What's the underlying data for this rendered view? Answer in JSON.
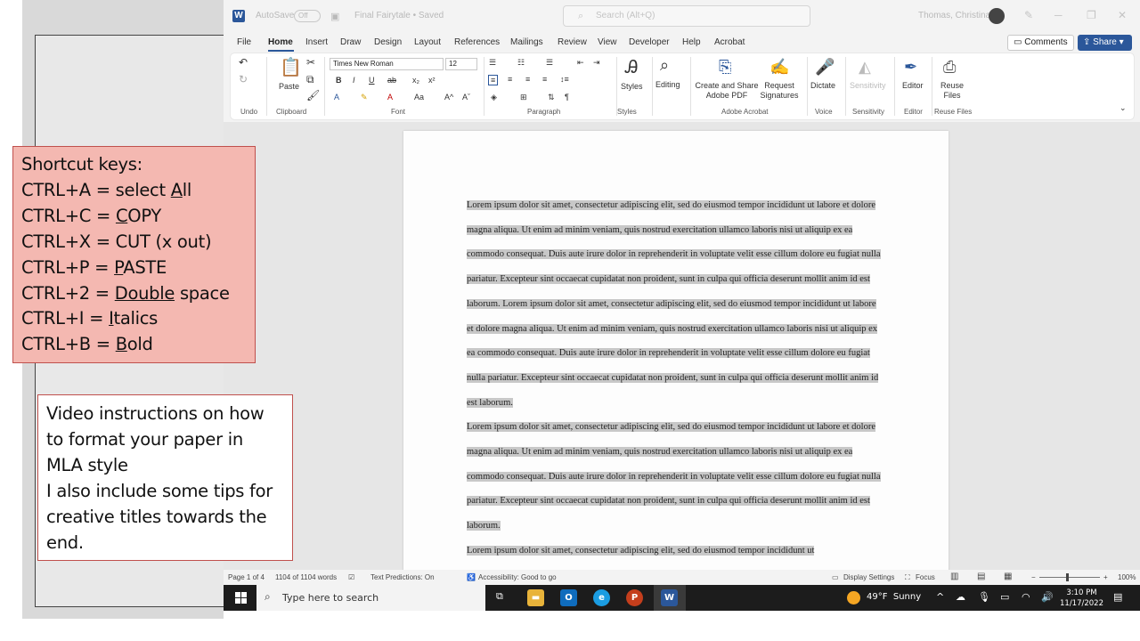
{
  "titlebar": {
    "autosave_label": "AutoSave",
    "autosave_state": "Off",
    "document_title": "Final Fairytale • Saved",
    "search_placeholder": "Search (Alt+Q)",
    "user_name": "Thomas, Christina"
  },
  "menu": {
    "tabs": [
      "File",
      "Home",
      "Insert",
      "Draw",
      "Design",
      "Layout",
      "References",
      "Mailings",
      "Review",
      "View",
      "Developer",
      "Help",
      "Acrobat"
    ],
    "active_tab": "Home",
    "comments_label": "Comments",
    "share_label": "Share"
  },
  "ribbon": {
    "paste_label": "Paste",
    "font_name": "Times New Roman",
    "font_size": "12",
    "styles_label": "Styles",
    "editing_label": "Editing",
    "create_share_label_1": "Create and Share",
    "create_share_label_2": "Adobe PDF",
    "request_sig_label_1": "Request",
    "request_sig_label_2": "Signatures",
    "dictate_label": "Dictate",
    "sensitivity_label": "Sensitivity",
    "editor_label": "Editor",
    "reuse_label_1": "Reuse",
    "reuse_label_2": "Files",
    "groups": {
      "undo": "Undo",
      "clipboard": "Clipboard",
      "font": "Font",
      "paragraph": "Paragraph",
      "styles": "Styles",
      "acrobat": "Adobe Acrobat",
      "voice": "Voice",
      "sensitivity": "Sensitivity",
      "editor": "Editor",
      "reuse": "Reuse Files"
    }
  },
  "document": {
    "paragraph_1": "Lorem ipsum dolor sit amet, consectetur adipiscing elit, sed do eiusmod tempor incididunt ut labore et dolore magna aliqua. Ut enim ad minim veniam, quis nostrud exercitation ullamco laboris nisi ut aliquip ex ea commodo consequat. Duis aute irure dolor in reprehenderit in voluptate velit esse cillum dolore eu fugiat nulla pariatur. Excepteur sint occaecat cupidatat non proident, sunt in culpa qui officia deserunt mollit anim id est laborum. Lorem ipsum dolor sit amet, consectetur adipiscing elit, sed do eiusmod tempor incididunt ut labore et dolore magna aliqua. Ut enim ad minim veniam, quis nostrud exercitation ullamco laboris nisi ut aliquip ex ea commodo consequat. Duis aute irure dolor in reprehenderit in voluptate velit esse cillum dolore eu fugiat nulla pariatur. Excepteur sint occaecat cupidatat non proident, sunt in culpa qui officia deserunt mollit anim id est laborum.",
    "paragraph_2": "Lorem ipsum dolor sit amet, consectetur adipiscing elit, sed do eiusmod tempor incididunt ut labore et dolore magna aliqua. Ut enim ad minim veniam, quis nostrud exercitation ullamco laboris nisi ut aliquip ex ea commodo consequat. Duis aute irure dolor in reprehenderit in voluptate velit esse cillum dolore eu fugiat nulla pariatur. Excepteur sint occaecat cupidatat non proident, sunt in culpa qui officia deserunt mollit anim id est laborum.",
    "paragraph_3": "Lorem ipsum dolor sit amet, consectetur adipiscing elit, sed do eiusmod tempor incididunt ut"
  },
  "statusbar": {
    "page": "Page 1 of 4",
    "words": "1104 of 1104 words",
    "text_predictions": "Text Predictions: On",
    "accessibility": "Accessibility: Good to go",
    "display_settings": "Display Settings",
    "focus": "Focus",
    "zoom": "100%"
  },
  "taskbar": {
    "search_placeholder": "Type here to search",
    "weather_temp": "49°F",
    "weather_desc": "Sunny",
    "time": "3:10 PM",
    "date": "11/17/2022"
  },
  "overlay": {
    "shortcuts_title": "Shortcut keys:",
    "shortcuts": [
      {
        "prefix": "CTRL+A = select ",
        "underlined": "A",
        "suffix": "ll"
      },
      {
        "prefix": "CTRL+C = ",
        "underlined": "C",
        "suffix": "OPY"
      },
      {
        "prefix": "CTRL+X = CUT (x out)",
        "underlined": "",
        "suffix": ""
      },
      {
        "prefix": "CTRL+P = ",
        "underlined": "P",
        "suffix": "ASTE"
      },
      {
        "prefix": "CTRL+2 = ",
        "underlined": "Double",
        "suffix": " space"
      },
      {
        "prefix": "CTRL+I = ",
        "underlined": "I",
        "suffix": "talics"
      },
      {
        "prefix": "CTRL+B = ",
        "underlined": "B",
        "suffix": "old"
      }
    ],
    "video_text_1": "Video instructions on how to format your paper in MLA style",
    "video_text_2": "I also include some tips for creative titles towards the end."
  },
  "colors": {
    "word_blue": "#2b579a",
    "shortcut_fill": "#f4b8b1",
    "box_border": "#c0504d",
    "selection": "#c8c8c8"
  },
  "icons": [
    "word-app-icon",
    "search-icon",
    "undo-icon",
    "redo-icon",
    "paste-icon",
    "cut-icon",
    "format-painter-icon",
    "bold-icon",
    "italic-icon",
    "underline-icon",
    "styles-icon",
    "editing-icon",
    "adobe-pdf-icon",
    "signature-icon",
    "microphone-icon",
    "sensitivity-icon",
    "editor-icon",
    "reuse-files-icon",
    "windows-start-icon",
    "outlook-icon",
    "edge-icon",
    "powerpoint-icon",
    "word-taskbar-icon",
    "weather-sun-icon"
  ]
}
